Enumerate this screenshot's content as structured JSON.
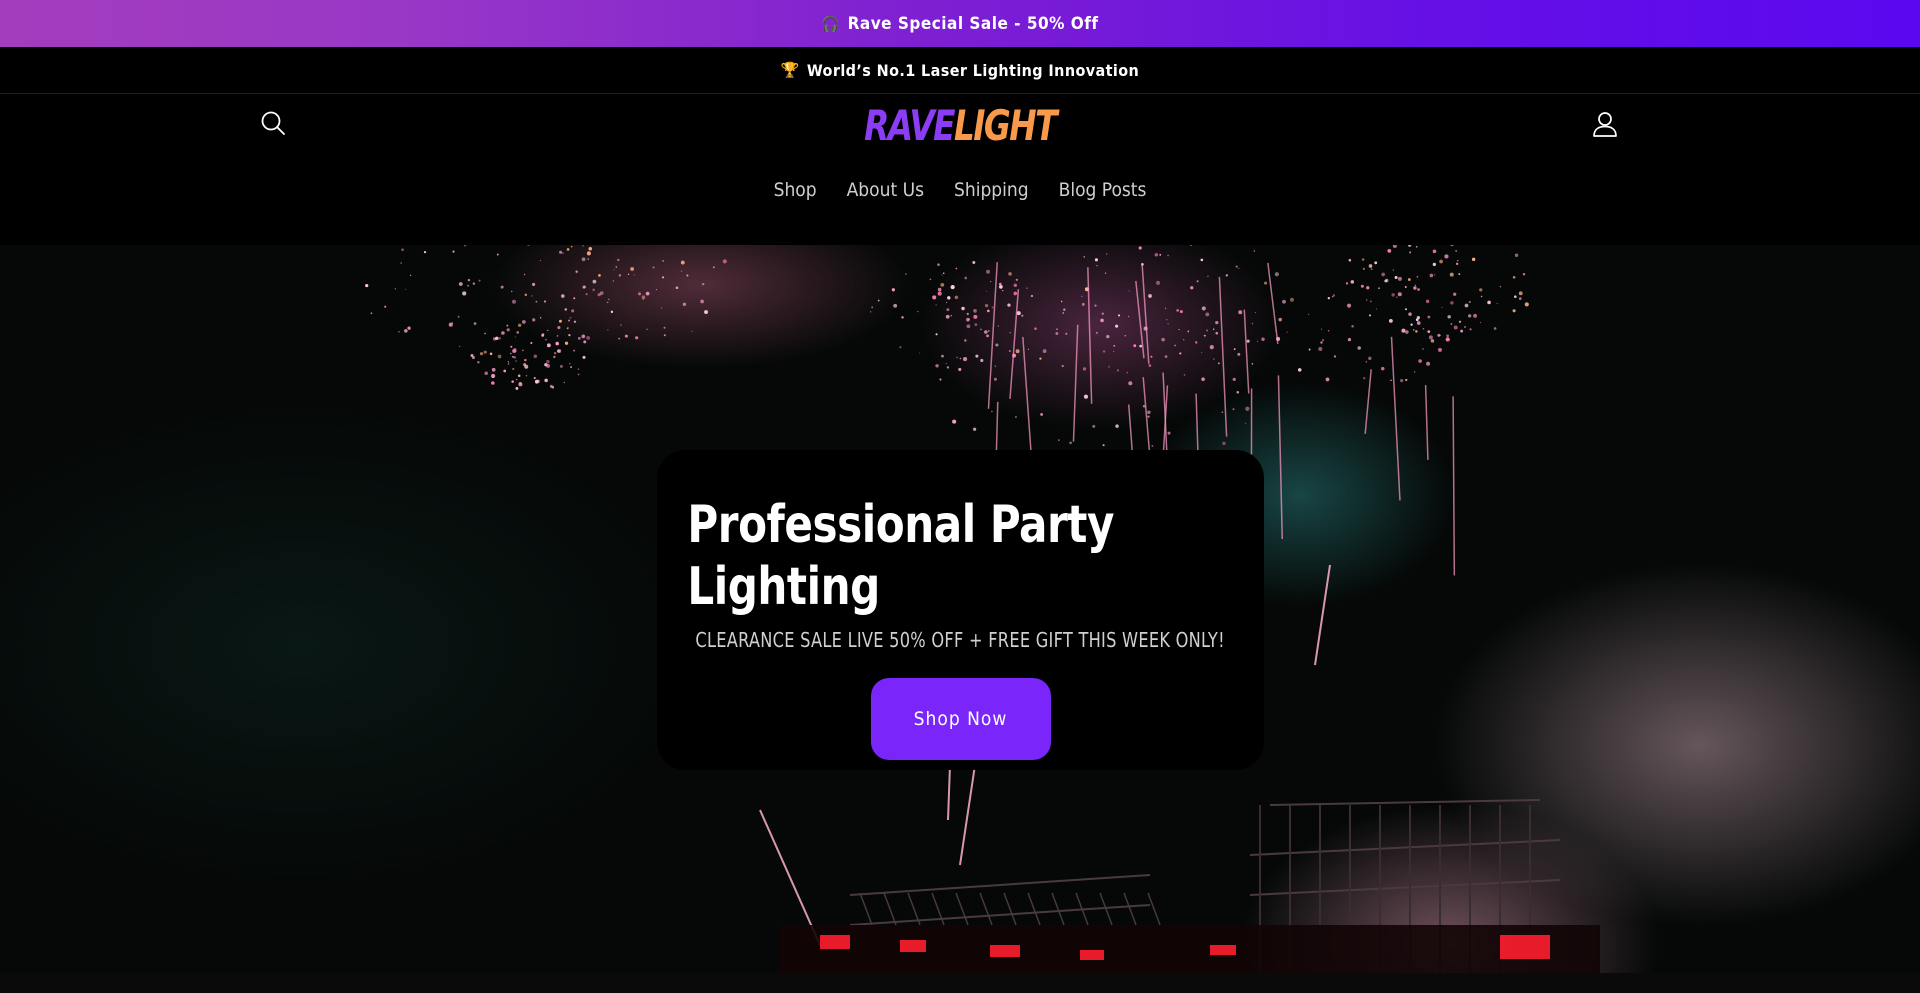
{
  "promo_bar": {
    "emoji": "🎧",
    "text": "Rave Special Sale - 50% Off"
  },
  "announcement": {
    "emoji": "🏆",
    "text": "World’s No.1 Laser Lighting Innovation"
  },
  "header": {
    "logo": {
      "part1": "RAVE",
      "part2": "LIGHT"
    },
    "nav": [
      {
        "label": "Shop"
      },
      {
        "label": "About Us"
      },
      {
        "label": "Shipping"
      },
      {
        "label": "Blog Posts"
      }
    ],
    "icons": {
      "search": "search-icon",
      "account": "user-icon"
    }
  },
  "hero": {
    "title": "Professional Party Lighting",
    "subtitle": "CLEARANCE SALE LIVE 50% OFF + FREE GIFT THIS WEEK ONLY!",
    "cta_label": "Shop Now"
  },
  "colors": {
    "promo_gradient_start": "#a33dbd",
    "promo_gradient_end": "#5a08f0",
    "logo_rave": "#8b3df5",
    "logo_light": "#f99a4a",
    "cta": "#7a25fa"
  }
}
